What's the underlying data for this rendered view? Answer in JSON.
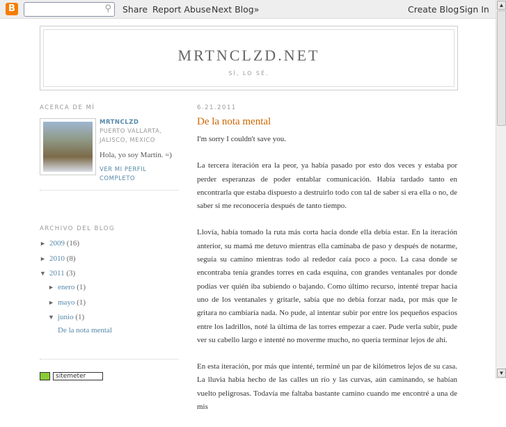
{
  "navbar": {
    "logo": "B",
    "search_icon": "search-icon",
    "share": "Share",
    "report": "Report Abuse",
    "next": "Next Blog»",
    "create": "Create Blog",
    "signin": "Sign In"
  },
  "header": {
    "title": "MRTNCLZD.NET",
    "description": "SÍ, LO SÉ."
  },
  "about": {
    "heading": "ACERCA DE MÍ",
    "name": "MRTNCLZD",
    "location1": "PUERTO VALLARTA,",
    "location2": "JALISCO, MEXICO",
    "bio": "Hola, yo soy Martín. =)",
    "profile_link": "VER MI PERFIL COMPLETO"
  },
  "archive": {
    "heading": "ARCHIVO DEL BLOG",
    "items": [
      {
        "label": "2009",
        "count": "(16)"
      },
      {
        "label": "2010",
        "count": "(8)"
      },
      {
        "label": "2011",
        "count": "(3)"
      },
      {
        "label": "enero",
        "count": "(1)"
      },
      {
        "label": "mayo",
        "count": "(1)"
      },
      {
        "label": "junio",
        "count": "(1)"
      }
    ],
    "post": "De la nota mental"
  },
  "sitemeter": "sitemeter",
  "post": {
    "date": "6.21.2011",
    "title": "De la nota mental",
    "paragraphs": [
      "I'm sorry I couldn't save you.",
      "La tercera iteración era la peor, ya había pasado por esto dos veces y estaba por perder esperanzas de poder entablar comunicación. Había tardado tanto en encontrarla que estaba dispuesto a destruirlo todo con tal de saber si era ella o no, de saber si me reconocería después de tanto tiempo.",
      "Llovía, había tomado la ruta más corta hacia donde ella debía estar. En la iteración anterior, su mamá me detuvo mientras ella caminaba de paso y después de notarme, seguía su camino mientras todo al rededor caía poco a poco. La casa donde se encontraba tenía grandes torres en cada esquina, con grandes ventanales por donde podías ver quién iba subiendo o bajando. Como último recurso, intenté trepar hacia uno de los ventanales y gritarle, sabía que no debía forzar nada, por más que le gritara no cambiaría nada. No pude, al intentar subir por entre los pequeños espacios entre los ladrillos, noté la última de las torres empezar a caer. Pude verla subir, pude ver su cabello largo e intenté no moverme mucho, no quería terminar lejos de ahí.",
      "En esta iteración, por más que intenté, terminé un par de kilómetros lejos de su casa. La lluvia había hecho de las calles un río y las curvas, aún caminando, se habían vuelto peligrosas. Todavía me faltaba bastante camino cuando me encontré a una de mis"
    ]
  }
}
